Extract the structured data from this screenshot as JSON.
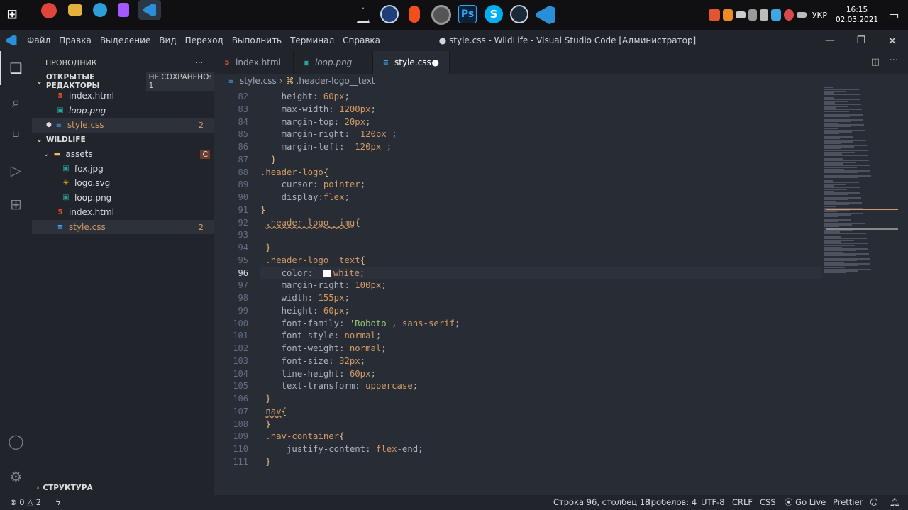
{
  "taskbar": {
    "start": "⊞",
    "tray": {
      "lang": "УКР",
      "time": "16:15",
      "date": "02.03.2021"
    }
  },
  "titlebar": {
    "menu": [
      "Файл",
      "Правка",
      "Выделение",
      "Вид",
      "Переход",
      "Выполнить",
      "Терминал",
      "Справка"
    ],
    "title": "● style.css - WildLife - Visual Studio Code [Администратор]"
  },
  "sidebar": {
    "title": "ПРОВОДНИК",
    "open_editors": "ОТКРЫТЫЕ РЕДАКТОРЫ",
    "unsaved": "НЕ СОХРАНЕНО: 1",
    "open": [
      {
        "name": "index.html",
        "icon": "html"
      },
      {
        "name": "loop.png",
        "icon": "img",
        "italic": true
      },
      {
        "name": "style.css",
        "icon": "css",
        "badge": "2",
        "modified": true
      }
    ],
    "project": "WILDLIFE",
    "folder": "assets",
    "folder_badge": "C",
    "files": [
      {
        "name": "fox.jpg"
      },
      {
        "name": "logo.svg"
      },
      {
        "name": "loop.png"
      }
    ],
    "root_files": [
      {
        "name": "index.html"
      },
      {
        "name": "style.css",
        "badge": "2"
      }
    ],
    "structure": "СТРУКТУРА"
  },
  "tabs": [
    {
      "label": "index.html"
    },
    {
      "label": "loop.png"
    },
    {
      "label": "style.css"
    }
  ],
  "breadcrumb": {
    "file": "style.css",
    "symbol": ".header-logo__text"
  },
  "code": {
    "lines": [
      {
        "n": "82",
        "t": "    height: 60px;"
      },
      {
        "n": "83",
        "t": "    max-width: 1200px;"
      },
      {
        "n": "84",
        "t": "    margin-top: 20px;"
      },
      {
        "n": "85",
        "t": "    margin-right:  120px ;"
      },
      {
        "n": "86",
        "t": "    margin-left:  120px ;"
      },
      {
        "n": "87",
        "t": "  }"
      },
      {
        "n": "88",
        "t": ".header-logo{"
      },
      {
        "n": "89",
        "t": "    cursor: pointer;"
      },
      {
        "n": "90",
        "t": "    display:flex;"
      },
      {
        "n": "91",
        "t": "}"
      },
      {
        "n": "92",
        "t": " .header-logo__img{"
      },
      {
        "n": "93",
        "t": ""
      },
      {
        "n": "94",
        "t": " }"
      },
      {
        "n": "95",
        "t": " .header-logo__text{"
      },
      {
        "n": "96",
        "t": "    color:  white;"
      },
      {
        "n": "97",
        "t": "    margin-right: 100px;"
      },
      {
        "n": "98",
        "t": "    width: 155px;"
      },
      {
        "n": "99",
        "t": "    height: 60px;"
      },
      {
        "n": "100",
        "t": "    font-family: 'Roboto', sans-serif;"
      },
      {
        "n": "101",
        "t": "    font-style: normal;"
      },
      {
        "n": "102",
        "t": "    font-weight: normal;"
      },
      {
        "n": "103",
        "t": "    font-size: 32px;"
      },
      {
        "n": "104",
        "t": "    line-height: 60px;"
      },
      {
        "n": "105",
        "t": "    text-transform: uppercase;"
      },
      {
        "n": "106",
        "t": " }"
      },
      {
        "n": "107",
        "t": " nav{"
      },
      {
        "n": "108",
        "t": " }"
      },
      {
        "n": "109",
        "t": " .nav-container{"
      },
      {
        "n": "110",
        "t": "     justify-content: flex-end;"
      },
      {
        "n": "111",
        "t": " }"
      }
    ]
  },
  "status": {
    "problems_err": "0",
    "problems_warn": "2",
    "position": "Строка 96, столбец 18",
    "spaces": "Пробелов: 4",
    "encoding": "UTF-8",
    "eol": "CRLF",
    "lang": "CSS",
    "golive": "Go Live",
    "prettier": "Prettier"
  }
}
